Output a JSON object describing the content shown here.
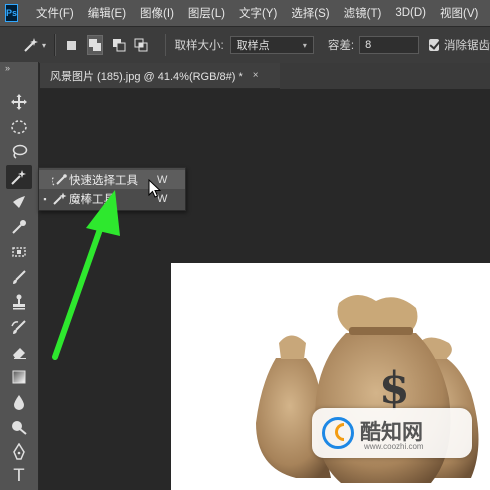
{
  "app": {
    "logo": "Ps"
  },
  "menu": [
    "文件(F)",
    "编辑(E)",
    "图像(I)",
    "图层(L)",
    "文字(Y)",
    "选择(S)",
    "滤镜(T)",
    "3D(D)",
    "视图(V)"
  ],
  "options_bar": {
    "sample_size_label": "取样大小:",
    "sample_size_value": "取样点",
    "tolerance_label": "容差:",
    "tolerance_value": "8",
    "antialias_label": "消除锯齿",
    "antialias_checked": true
  },
  "document_tab": {
    "title": "风景图片 (185).jpg @ 41.4%(RGB/8#) *",
    "close": "×"
  },
  "flyout": {
    "items": [
      {
        "label": "快速选择工具",
        "shortcut": "W",
        "selected": false,
        "icon": "quick-selection-icon"
      },
      {
        "label": "魔棒工具",
        "shortcut": "W",
        "selected": true,
        "icon": "magic-wand-icon"
      }
    ],
    "bullet": "▪"
  },
  "toolbar": {
    "collapse": "»",
    "tools": [
      "move-icon",
      "marquee-icon",
      "lasso-icon",
      "magic-wand-icon",
      "crop-icon",
      "eyedropper-icon",
      "healing-brush-icon",
      "brush-icon",
      "clone-stamp-icon",
      "history-brush-icon",
      "eraser-icon",
      "gradient-icon",
      "blur-icon",
      "dodge-icon",
      "pen-icon",
      "type-icon"
    ],
    "type_glyph": "T"
  },
  "watermark": {
    "text": "酷知网",
    "url": "www.coozhi.com"
  },
  "colors": {
    "accent_annotation": "#2ee82e",
    "menubar": "#535353",
    "canvas": "#282828"
  }
}
